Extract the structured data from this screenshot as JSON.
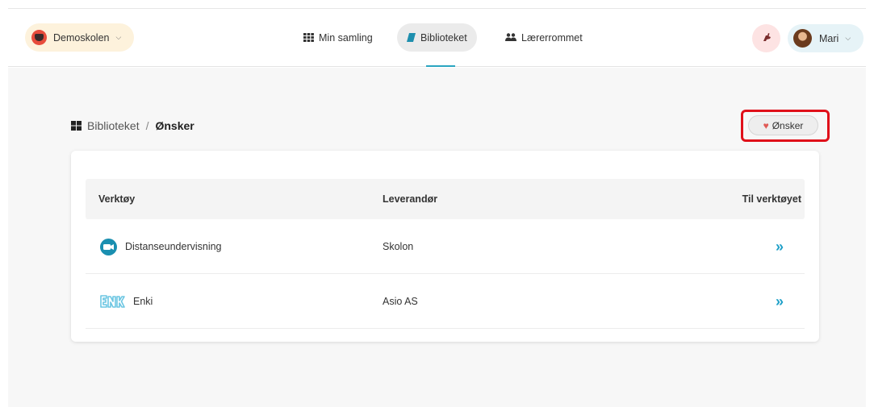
{
  "header": {
    "school": "Demoskolen",
    "nav": [
      {
        "label": "Min samling",
        "icon": "grid-icon"
      },
      {
        "label": "Biblioteket",
        "icon": "book-icon",
        "active": true
      },
      {
        "label": "Lærerrommet",
        "icon": "users-icon"
      }
    ],
    "user": "Mari",
    "accent": "#2aa5c0"
  },
  "breadcrumb": {
    "root": "Biblioteket",
    "separator": "/",
    "current": "Ønsker"
  },
  "wish_button": {
    "label": "Ønsker",
    "icon": "heart-icon",
    "color": "#e05a55"
  },
  "table": {
    "columns": [
      "Verktøy",
      "Leverandør",
      "Til verktøyet"
    ],
    "rows": [
      {
        "tool": "Distanseundervisning",
        "vendor": "Skolon",
        "icon": "video-camera-icon",
        "go": "»"
      },
      {
        "tool": "Enki",
        "vendor": "Asio AS",
        "icon": "enki-logo-icon",
        "go": "»"
      }
    ]
  }
}
